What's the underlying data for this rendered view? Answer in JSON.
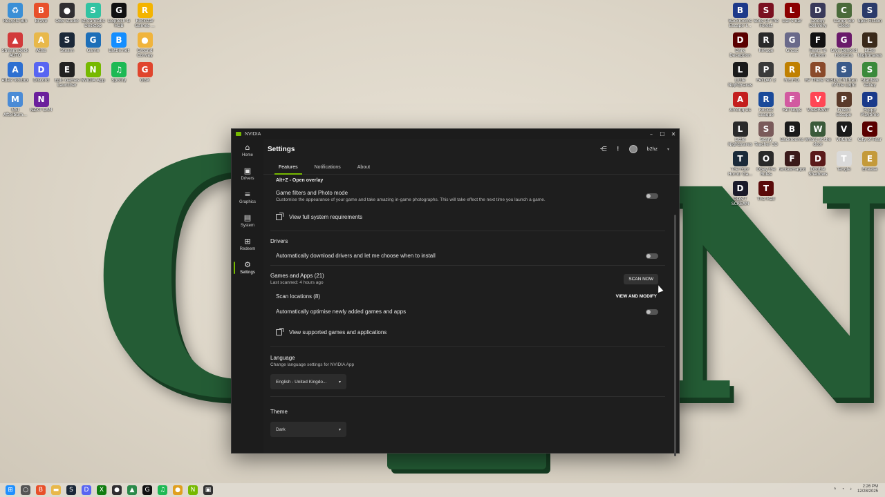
{
  "desktop": {
    "left_icons": [
      {
        "label": "Recycle Bin",
        "icon": "recycle-bin-icon",
        "color": "#3b8fd6",
        "glyph": "♻"
      },
      {
        "label": "Brave",
        "icon": "brave-icon",
        "color": "#e8502a",
        "glyph": "B"
      },
      {
        "label": "OBS Studio",
        "icon": "obs-icon",
        "color": "#302e31",
        "glyph": "●"
      },
      {
        "label": "Streamlabs Desktop",
        "icon": "streamlabs-icon",
        "color": "#31c3a2",
        "glyph": "S"
      },
      {
        "label": "Logitech G HUB",
        "icon": "ghub-icon",
        "color": "#111111",
        "glyph": "G"
      },
      {
        "label": "Rockstar Games ...",
        "icon": "rockstar-icon",
        "color": "#f4b400",
        "glyph": "R"
      },
      {
        "label": "Stream Deck AUTO",
        "icon": "streamdeck-icon",
        "color": "#d23a3a",
        "glyph": "▲"
      },
      {
        "label": "Atlas",
        "icon": "atlas-icon",
        "color": "#e8b84a",
        "glyph": "A"
      },
      {
        "label": "Steam",
        "icon": "steam-icon",
        "color": "#1b2838",
        "glyph": "S"
      },
      {
        "label": "Game",
        "icon": "game-icon",
        "color": "#1d6fb8",
        "glyph": "G"
      },
      {
        "label": "Battle.net",
        "icon": "battlenet-icon",
        "color": "#148eff",
        "glyph": "B"
      },
      {
        "label": "Ground Convey",
        "icon": "ground-icon",
        "color": "#f0b43c",
        "glyph": "●"
      },
      {
        "label": "Atlas Toolbox",
        "icon": "atlas-toolbox-icon",
        "color": "#2d6fd1",
        "glyph": "A"
      },
      {
        "label": "Discord",
        "icon": "discord-icon",
        "color": "#5865f2",
        "glyph": "D"
      },
      {
        "label": "Epic Games Launcher",
        "icon": "epic-icon",
        "color": "#222222",
        "glyph": "E"
      },
      {
        "label": "NVIDIA App",
        "icon": "nvidia-icon",
        "color": "#76b900",
        "glyph": "N"
      },
      {
        "label": "Spotify",
        "icon": "spotify-icon",
        "color": "#1db954",
        "glyph": "♫"
      },
      {
        "label": "GGX",
        "icon": "ggx-icon",
        "color": "#e0452d",
        "glyph": "G"
      },
      {
        "label": "MSI Afterburn...",
        "icon": "msi-icon",
        "color": "#4a8bd6",
        "glyph": "M"
      },
      {
        "label": "NZXT CAM",
        "icon": "nzxt-icon",
        "color": "#6b1f9c",
        "glyph": "N"
      }
    ],
    "right_icons": [
      {
        "label": "Backrooms Escape T...",
        "icon": "game-icon",
        "color": "#1e3a8a",
        "glyph": "B"
      },
      {
        "label": "Sons Of The Forest",
        "icon": "game-icon",
        "color": "#7a1020",
        "glyph": "S"
      },
      {
        "label": "Liar's Bar",
        "icon": "game-icon",
        "color": "#8b0000",
        "glyph": "L"
      },
      {
        "label": "Dodgy Delivery",
        "icon": "game-icon",
        "color": "#3a3a5a",
        "glyph": "D"
      },
      {
        "label": "Camp Too Close",
        "icon": "game-icon",
        "color": "#4a6a3a",
        "glyph": "C"
      },
      {
        "label": "Split Fiction",
        "icon": "game-icon",
        "color": "#2a3a6a",
        "glyph": "S"
      },
      {
        "label": "Dark Deception",
        "icon": "game-icon",
        "color": "#5a0000",
        "glyph": "D"
      },
      {
        "label": "Refuge",
        "icon": "game-icon",
        "color": "#2a2a2a",
        "glyph": "R"
      },
      {
        "label": "Ghost",
        "icon": "game-icon",
        "color": "#6a6a8a",
        "glyph": "G"
      },
      {
        "label": "Fears To Fathom",
        "icon": "game-icon",
        "color": "#111111",
        "glyph": "F"
      },
      {
        "label": "Give Beyond Horizons",
        "icon": "game-icon",
        "color": "#6a1a6a",
        "glyph": "G"
      },
      {
        "label": "Little Nightmares",
        "icon": "game-icon",
        "color": "#3a2a1a",
        "glyph": "L"
      },
      {
        "label": "Little Nightmares II",
        "icon": "game-icon",
        "color": "#1a1a1a",
        "glyph": "L"
      },
      {
        "label": "PAYDAY 2",
        "icon": "game-icon",
        "color": "#3a3a3a",
        "glyph": "P"
      },
      {
        "label": "R.E.P.O.",
        "icon": "game-icon",
        "color": "#c08000",
        "glyph": "R"
      },
      {
        "label": "RV There Yet",
        "icon": "game-icon",
        "color": "#8a4a2a",
        "glyph": "R"
      },
      {
        "label": "Sky Children of the Light",
        "icon": "game-icon",
        "color": "#3a5a8a",
        "glyph": "S"
      },
      {
        "label": "Stardew Valley",
        "icon": "game-icon",
        "color": "#3a8a3a",
        "glyph": "S"
      },
      {
        "label": "Among Us",
        "icon": "game-icon",
        "color": "#c41e1e",
        "glyph": "A"
      },
      {
        "label": "Rocket League",
        "icon": "game-icon",
        "color": "#1a4a9a",
        "glyph": "R"
      },
      {
        "label": "Fall Guys",
        "icon": "game-icon",
        "color": "#d25aa0",
        "glyph": "F"
      },
      {
        "label": "VALORANT",
        "icon": "game-icon",
        "color": "#ff4655",
        "glyph": "V"
      },
      {
        "label": "Prison Escape",
        "icon": "game-icon",
        "color": "#5a3a2a",
        "glyph": "P"
      },
      {
        "label": "Poppy Playtime",
        "icon": "game-icon",
        "color": "#1a3a8a",
        "glyph": "P"
      },
      {
        "label": "Little Nightmares III",
        "icon": "game-icon",
        "color": "#2a2a2a",
        "glyph": "L"
      },
      {
        "label": "Scary Teacher 3D",
        "icon": "game-icon",
        "color": "#7a5a5a",
        "glyph": "S"
      },
      {
        "label": "Backrooms",
        "icon": "game-icon",
        "color": "#1a1a1a",
        "glyph": "B"
      },
      {
        "label": "Who's at the door",
        "icon": "game-icon",
        "color": "#3a5a3a",
        "glyph": "W"
      },
      {
        "label": "VRChat",
        "icon": "game-icon",
        "color": "#1a1a1a",
        "glyph": "V"
      },
      {
        "label": "City of Fear",
        "icon": "game-icon",
        "color": "#5a0000",
        "glyph": "C"
      },
      {
        "label": "The Poor Horror Ga...",
        "icon": "game-icon",
        "color": "#1a2a3a",
        "glyph": "T"
      },
      {
        "label": "Obey the Rules",
        "icon": "game-icon",
        "color": "#2a2a2a",
        "glyph": "O"
      },
      {
        "label": "Fantasmagoria",
        "icon": "game-icon",
        "color": "#3a1a1a",
        "glyph": "F"
      },
      {
        "label": "Double Shadows",
        "icon": "game-icon",
        "color": "#5a1a1a",
        "glyph": "D"
      },
      {
        "label": "Tangle",
        "icon": "game-icon",
        "color": "#dadada",
        "glyph": "T"
      },
      {
        "label": "Eneasa",
        "icon": "game-icon",
        "color": "#c49a3a",
        "glyph": "E"
      },
      {
        "label": "DON'T SCREAM",
        "icon": "game-icon",
        "color": "#1a1a2a",
        "glyph": "D"
      },
      {
        "label": "The Mall",
        "icon": "game-icon",
        "color": "#5a0a0a",
        "glyph": "T"
      }
    ]
  },
  "window": {
    "app_name": "NVIDIA",
    "minimize": "–",
    "maximize": "☐",
    "close": "✕"
  },
  "sidebar": {
    "items": [
      {
        "label": "Home",
        "glyph": "⌂",
        "icon": "home-icon"
      },
      {
        "label": "Drivers",
        "glyph": "▣",
        "icon": "drivers-icon"
      },
      {
        "label": "Graphics",
        "glyph": "≡",
        "icon": "graphics-icon"
      },
      {
        "label": "System",
        "glyph": "▤",
        "icon": "system-icon"
      },
      {
        "label": "Redeem",
        "glyph": "⊞",
        "icon": "redeem-icon"
      },
      {
        "label": "Settings",
        "glyph": "⚙",
        "icon": "settings-icon"
      }
    ],
    "active": "Settings"
  },
  "header": {
    "title": "Settings",
    "share_glyph": "⋲",
    "feedback_glyph": "!",
    "username": "b2hz",
    "chevron": "▾"
  },
  "tabs": [
    {
      "label": "Features",
      "active": true
    },
    {
      "label": "Notifications",
      "active": false
    },
    {
      "label": "About",
      "active": false
    }
  ],
  "content": {
    "overlay_shortcut": "Alt+Z - Open overlay",
    "game_filters": {
      "title": "Game filters and Photo mode",
      "description": "Customise the appearance of your game and take amazing in-game photographs. This will take effect the next time you launch a game.",
      "enabled": false
    },
    "system_requirements_link": "View full system requirements",
    "drivers": {
      "section_title": "Drivers",
      "auto_download_label": "Automatically download drivers and let me choose when to install",
      "enabled": false
    },
    "games_apps": {
      "section_title": "Games and Apps (21)",
      "last_scanned": "Last scanned: 4 hours ago",
      "scan_button": "SCAN NOW",
      "scan_locations": "Scan locations (8)",
      "view_modify": "VIEW AND MODIFY",
      "auto_optimise_label": "Automatically optimise newly added games and apps",
      "auto_optimise_enabled": false,
      "supported_link": "View supported games and applications"
    },
    "language": {
      "section_title": "Language",
      "description": "Change language settings for NVIDIA App",
      "selected": "English - United Kingdo..."
    },
    "theme": {
      "section_title": "Theme",
      "selected": "Dark"
    }
  },
  "taskbar": {
    "icons": [
      {
        "icon": "windows-start-icon",
        "color": "#1e90ff",
        "glyph": "⊞"
      },
      {
        "icon": "search-icon",
        "color": "#555555",
        "glyph": "○"
      },
      {
        "icon": "brave-icon",
        "color": "#e8502a",
        "glyph": "B"
      },
      {
        "icon": "file-explorer-icon",
        "color": "#e8b84a",
        "glyph": "▬"
      },
      {
        "icon": "steam-icon",
        "color": "#1b2838",
        "glyph": "S"
      },
      {
        "icon": "discord-icon",
        "color": "#5865f2",
        "glyph": "D"
      },
      {
        "icon": "xbox-icon",
        "color": "#107c10",
        "glyph": "X"
      },
      {
        "icon": "obs-icon",
        "color": "#302e31",
        "glyph": "●"
      },
      {
        "icon": "app-icon",
        "color": "#2a8a4a",
        "glyph": "▲"
      },
      {
        "icon": "ghub-icon",
        "color": "#111111",
        "glyph": "G"
      },
      {
        "icon": "spotify-icon",
        "color": "#1db954",
        "glyph": "♫"
      },
      {
        "icon": "app-icon",
        "color": "#e0a020",
        "glyph": "●"
      },
      {
        "icon": "nvidia-icon",
        "color": "#76b900",
        "glyph": "N"
      },
      {
        "icon": "nzxt-icon",
        "color": "#333333",
        "glyph": "▣"
      }
    ],
    "time": "2:26 PM",
    "date": "12/28/2025"
  },
  "colors": {
    "accent": "#76b900",
    "window_bg": "#1e1e1e",
    "wallpaper_letters": "#245c35"
  }
}
